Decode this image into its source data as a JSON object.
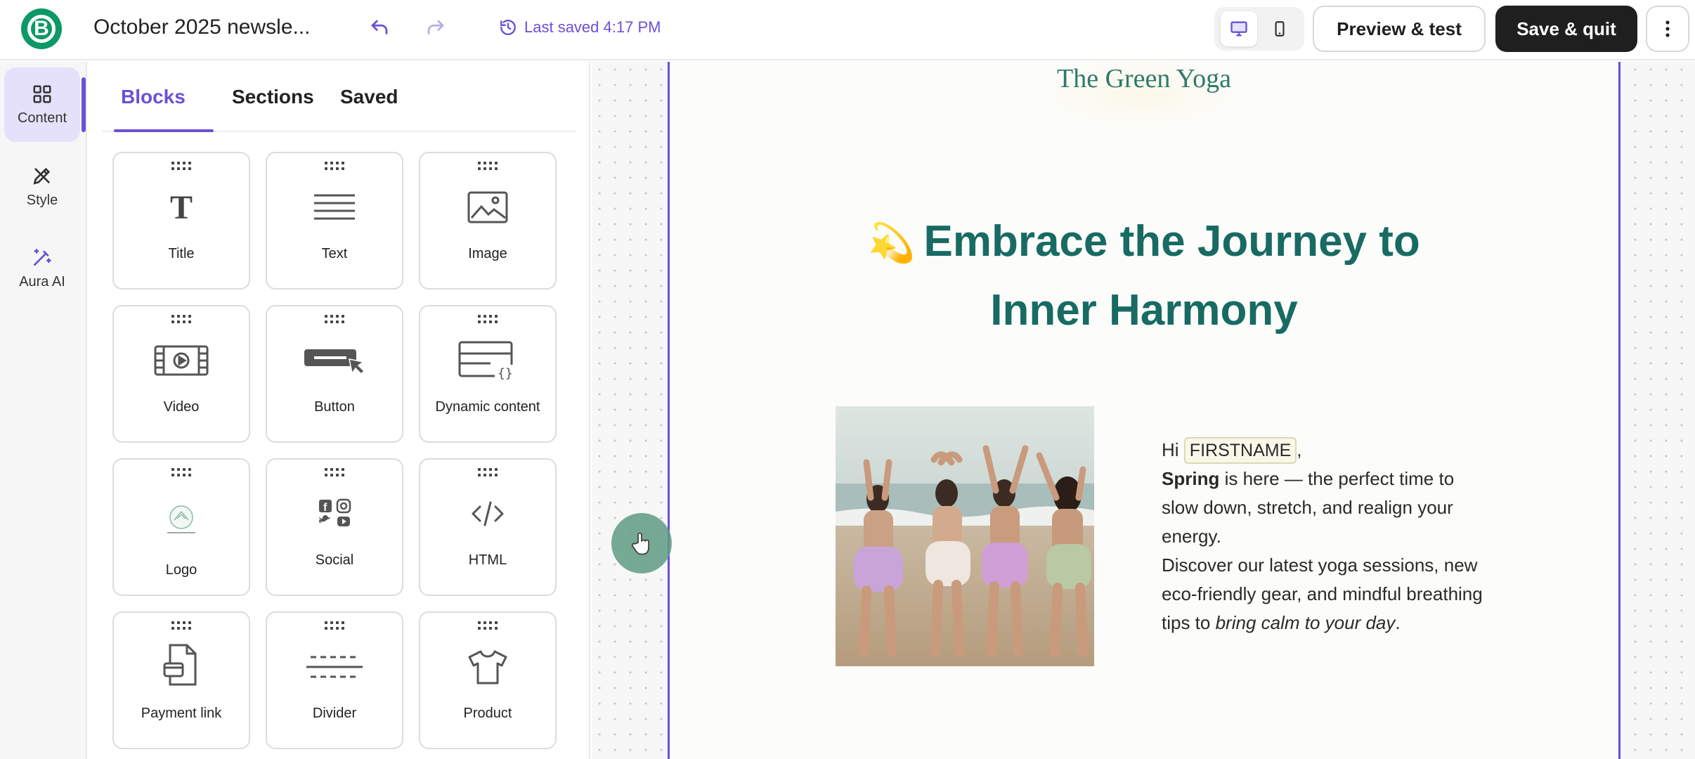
{
  "app": {
    "logo_letter": "B",
    "document_title": "October 2025 newsle...",
    "last_saved": "Last saved 4:17 PM",
    "accent_color": "#6b4fd8",
    "brand_color": "#0b9966"
  },
  "toolbar": {
    "preview_label": "Preview & test",
    "save_label": "Save & quit"
  },
  "rail": {
    "items": [
      {
        "label": "Content",
        "icon": "grid-icon",
        "active": true
      },
      {
        "label": "Style",
        "icon": "brush-pen-icon",
        "active": false
      },
      {
        "label": "Aura AI",
        "icon": "magic-wand-icon",
        "active": false
      }
    ]
  },
  "panel": {
    "tabs": [
      {
        "label": "Blocks",
        "active": true
      },
      {
        "label": "Sections",
        "active": false
      },
      {
        "label": "Saved",
        "active": false
      }
    ],
    "blocks": [
      {
        "label": "Title",
        "icon": "title-icon"
      },
      {
        "label": "Text",
        "icon": "text-lines-icon"
      },
      {
        "label": "Image",
        "icon": "image-icon"
      },
      {
        "label": "Video",
        "icon": "video-icon"
      },
      {
        "label": "Button",
        "icon": "button-icon"
      },
      {
        "label": "Dynamic content",
        "icon": "dynamic-content-icon"
      },
      {
        "label": "Logo",
        "icon": "logo-icon"
      },
      {
        "label": "Social",
        "icon": "social-icons"
      },
      {
        "label": "HTML",
        "icon": "code-icon"
      },
      {
        "label": "Payment link",
        "icon": "payment-link-icon"
      },
      {
        "label": "Divider",
        "icon": "divider-icon"
      },
      {
        "label": "Product",
        "icon": "tshirt-icon"
      }
    ]
  },
  "email": {
    "brand_name": "The Green Yoga",
    "headline_emoji": "💫",
    "headline_line1": "Embrace the Journey to",
    "headline_line2": "Inner Harmony",
    "greeting": "Hi",
    "merge_tag": "FIRSTNAME",
    "comma": ",",
    "spring_bold": "Spring",
    "para1_rest": " is here — the perfect time to slow down, stretch, and realign your energy.",
    "para2_start": "Discover our latest yoga sessions, new eco-friendly gear, and mindful breathing tips to ",
    "para2_italic": "bring calm to your day",
    "para2_end": ".",
    "headline_color": "#176b63"
  }
}
